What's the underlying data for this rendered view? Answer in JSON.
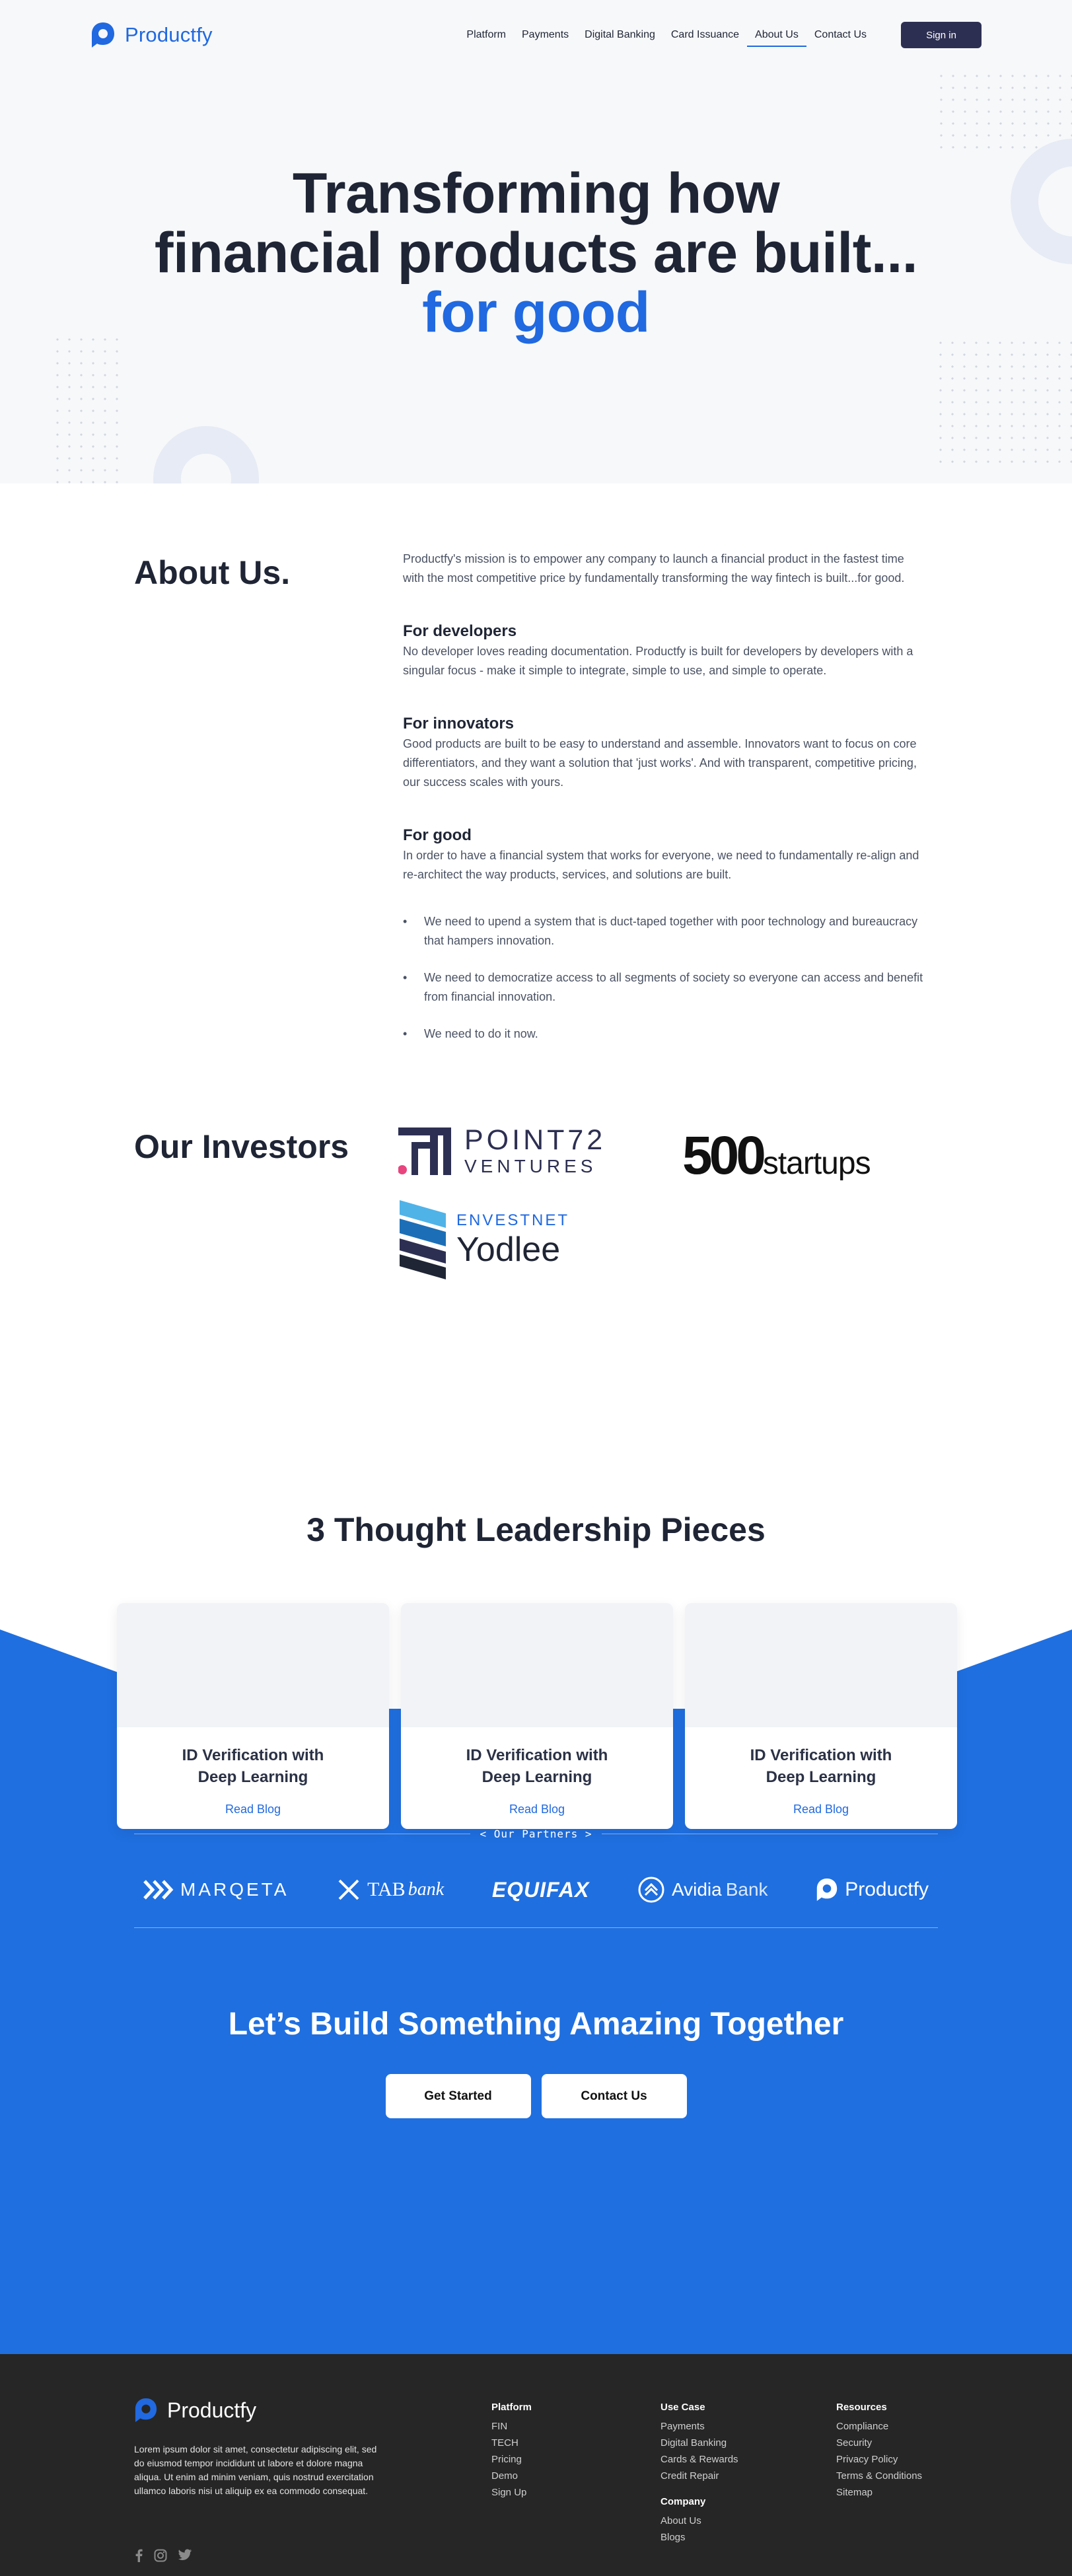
{
  "nav": {
    "brand": "Productfy",
    "links": [
      "Platform",
      "Payments",
      "Digital Banking",
      "Card Issuance",
      "About Us",
      "Contact Us"
    ],
    "active": "About Us",
    "signin": "Sign in"
  },
  "hero": {
    "line1": "Transforming how",
    "line2": "financial products are built...",
    "accent": "for good"
  },
  "about": {
    "heading": "About Us.",
    "intro": "Productfy's mission is to empower any company to launch a financial product in the fastest time with the most competitive price by fundamentally transforming the way fintech is built...for good.",
    "sections": [
      {
        "title": "For developers",
        "text": "No developer loves reading documentation. Productfy is built for developers by developers with a singular focus - make it simple to integrate, simple to use, and simple to operate."
      },
      {
        "title": "For innovators",
        "text": "Good products are built to be easy to understand and assemble. Innovators want to focus on core differentiators, and they want a solution that 'just works'. And with transparent, competitive pricing, our success scales with yours."
      },
      {
        "title": "For good",
        "text": "In order to have a financial system that works for everyone, we need to fundamentally re-align and re-architect the way products, services, and solutions are built."
      }
    ],
    "bullets": [
      "We need to upend a system that is duct-taped together with poor technology and bureaucracy that hampers innovation.",
      "We need to democratize access to all segments of society so everyone can access and benefit from financial innovation.",
      "We need to do it now."
    ]
  },
  "investors": {
    "heading": "Our Investors",
    "point72_top": "POINT72",
    "point72_bottom": "VENTURES",
    "startups_num": "500",
    "startups_word": "startups",
    "envestnet": "ENVESTNET",
    "yodlee": "Yodlee"
  },
  "thought": {
    "title": "3 Thought Leadership Pieces",
    "cards": [
      {
        "title": "ID Verification with Deep Learning",
        "link": "Read Blog"
      },
      {
        "title": "ID Verification with Deep Learning",
        "link": "Read Blog"
      },
      {
        "title": "ID Verification with Deep Learning",
        "link": "Read Blog"
      }
    ]
  },
  "partners": {
    "label": "< Our Partners >",
    "marqeta": "MARQETA",
    "tab": "TAB",
    "tab_suffix": "bank",
    "equifax": "EQUIFAX",
    "avidia": "Avidia",
    "avidia_suffix": "Bank",
    "productfy": "Productfy"
  },
  "cta": {
    "heading": "Let’s Build Something Amazing Together",
    "primary": "Get Started",
    "secondary": "Contact Us"
  },
  "footer": {
    "brand": "Productfy",
    "desc": "Lorem ipsum dolor sit amet, consectetur adipiscing elit, sed do eiusmod tempor incididunt ut labore et dolore magna aliqua. Ut enim ad minim veniam, quis nostrud exercitation ullamco laboris nisi ut aliquip ex ea commodo consequat.",
    "platform": {
      "title": "Platform",
      "links": [
        "FIN",
        "TECH",
        "Pricing",
        "Demo",
        "Sign Up"
      ]
    },
    "usecase": {
      "title": "Use Case",
      "links": [
        "Payments",
        "Digital Banking",
        "Cards & Rewards",
        "Credit Repair"
      ]
    },
    "company": {
      "title": "Company",
      "links": [
        "About Us",
        "Blogs"
      ]
    },
    "resources": {
      "title": "Resources",
      "links": [
        "Compliance",
        "Security",
        "Privacy Policy",
        "Terms & Conditions",
        "Sitemap"
      ]
    }
  },
  "colors": {
    "brand": "#2069e0",
    "dark": "#1f2535",
    "signin": "#2d2f52",
    "footer": "#262626"
  }
}
